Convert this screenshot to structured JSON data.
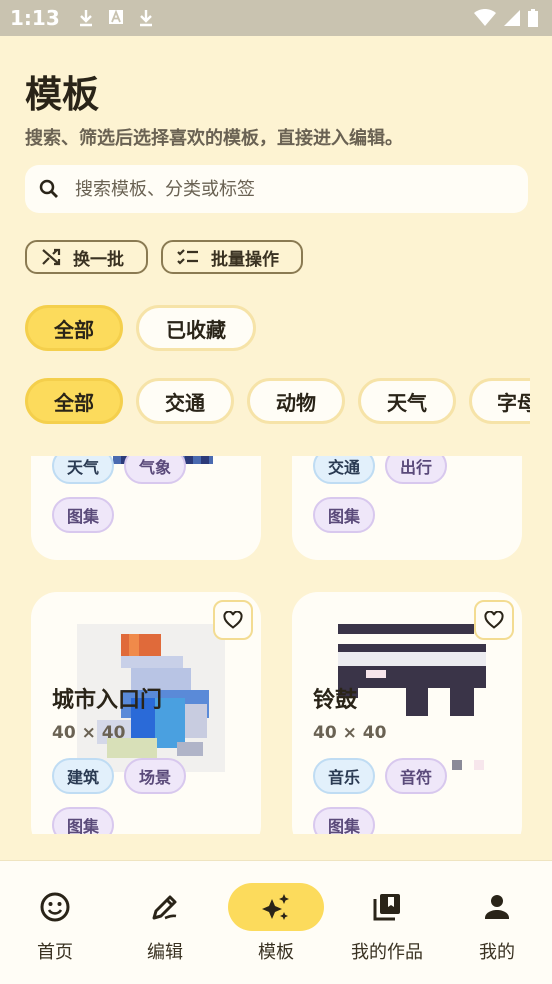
{
  "status_bar": {
    "time": "1:13"
  },
  "header": {
    "title": "模板",
    "subtitle": "搜索、筛选后选择喜欢的模板，直接进入编辑。"
  },
  "search": {
    "placeholder": "搜索模板、分类或标签",
    "value": ""
  },
  "actions": {
    "shuffle_label": "换一批",
    "batch_label": "批量操作"
  },
  "filter_tabs": [
    "全部",
    "已收藏"
  ],
  "categories": [
    "全部",
    "交通",
    "动物",
    "天气",
    "字母"
  ],
  "cards": [
    {
      "tags": [
        "天气",
        "气象"
      ],
      "extra_tag": "图集"
    },
    {
      "tags": [
        "交通",
        "出行"
      ],
      "extra_tag": "图集"
    },
    {
      "title": "城市入口门",
      "size": "40 × 40",
      "tags": [
        "建筑",
        "场景"
      ],
      "extra_tag": "图集"
    },
    {
      "title": "铃鼓",
      "size": "40 × 40",
      "tags": [
        "音乐",
        "音符"
      ],
      "extra_tag": "图集"
    }
  ],
  "nav": [
    {
      "label": "首页",
      "icon": "smiley-icon"
    },
    {
      "label": "编辑",
      "icon": "pencil-icon"
    },
    {
      "label": "模板",
      "icon": "sparkle-icon",
      "active": true
    },
    {
      "label": "我的作品",
      "icon": "library-icon"
    },
    {
      "label": "我的",
      "icon": "person-icon"
    }
  ],
  "colors": {
    "background": "#fdf3d2",
    "accent": "#fcdb5c",
    "card": "#fffdf6"
  }
}
